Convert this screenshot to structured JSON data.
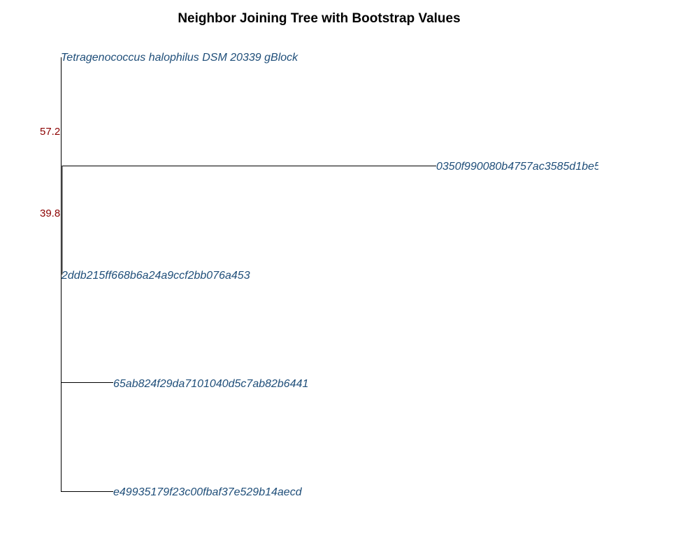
{
  "title": "Neighbor Joining Tree with Bootstrap Values",
  "colors": {
    "tip_label": "#1f4e79",
    "bootstrap_label": "#8b0000",
    "branch": "#000000"
  },
  "tips": [
    "Tetragenococcus halophilus DSM 20339 gBlock",
    "0350f990080b4757ac3585d1be5",
    "2ddb215ff668b6a24a9ccf2bb076a453",
    "65ab824f29da7101040d5c7ab82b6441",
    "e49935179f23c00fbaf37e529b14aecd"
  ],
  "bootstrap_values": [
    "57.2",
    "39.8"
  ]
}
